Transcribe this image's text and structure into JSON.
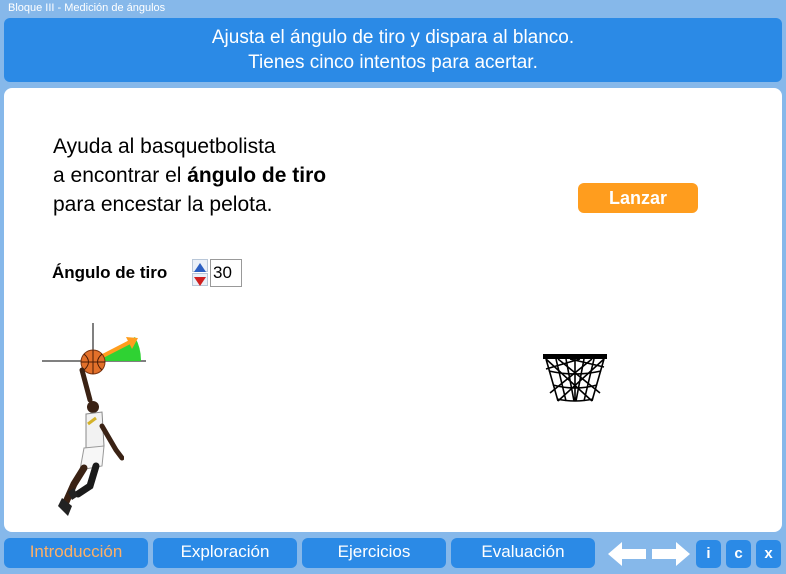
{
  "window": {
    "title": "Bloque III - Medición de ángulos"
  },
  "banner": {
    "line1": "Ajusta el ángulo de tiro y dispara al blanco.",
    "line2": "Tienes cinco intentos para acertar."
  },
  "intro": {
    "line1": "Ayuda al basquetbolista",
    "line2_pre": "a encontrar el ",
    "line2_bold": "ángulo de tiro",
    "line3": "para encestar la pelota."
  },
  "controls": {
    "launch_label": "Lanzar",
    "angle_label": "Ángulo de tiro",
    "angle_value": "30"
  },
  "nav": {
    "tabs": [
      {
        "label": "Introducción"
      },
      {
        "label": "Exploración"
      },
      {
        "label": "Ejercicios"
      },
      {
        "label": "Evaluación"
      }
    ],
    "info_label": "i",
    "credits_label": "c",
    "close_label": "x"
  },
  "colors": {
    "background": "#86b8ea",
    "accent_blue": "#2b8ae6",
    "launch_orange": "#ff9d1e",
    "active_tab_text": "#ffb066",
    "angle_indicator_green": "#2fd233"
  }
}
